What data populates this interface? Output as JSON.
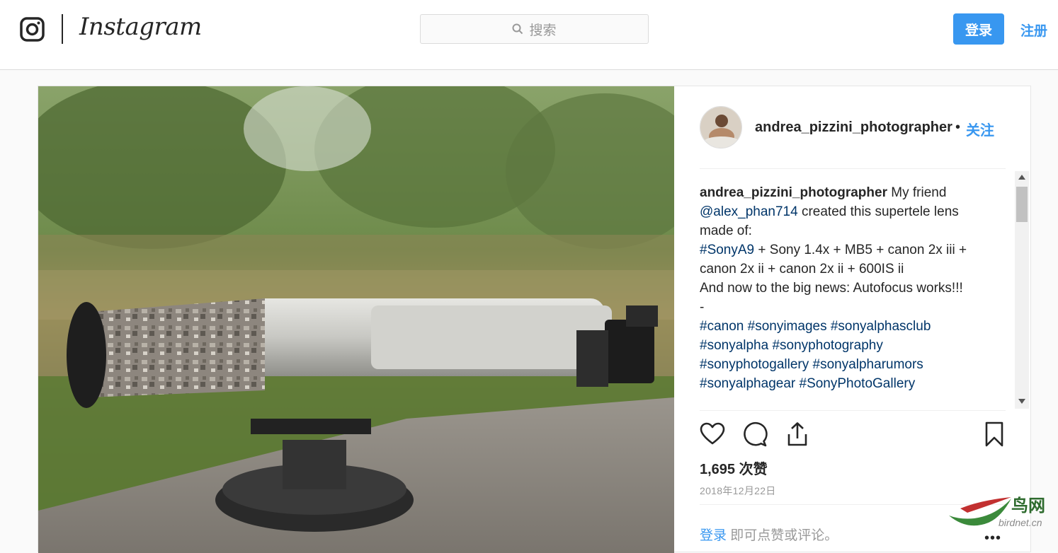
{
  "header": {
    "logo_text": "Instagram",
    "search_placeholder": "搜索",
    "login_label": "登录",
    "signup_label": "注册"
  },
  "post": {
    "author": "andrea_pizzini_photographer",
    "separator": "•",
    "follow_label": "关注",
    "caption": {
      "author": "andrea_pizzini_photographer",
      "text_1": " My friend ",
      "mention": "@alex_phan714",
      "text_2": " created this supertele lens made of:",
      "tag_sonya9": "#SonyA9",
      "text_3": " + Sony 1.4x + MB5 + canon 2x iii + canon 2x ii + canon 2x ii + 600IS ii",
      "text_4": "And now to the big news: Autofocus works!!!",
      "text_5": "-",
      "tags": [
        "#canon",
        "#sonyimages",
        "#sonyalphasclub",
        "#sonyalpha",
        "#sonyphotography",
        "#sonyphotogallery",
        "#sonyalpharumors",
        "#sonyalphagear",
        "#SonyPhotoGallery"
      ]
    },
    "likes_count": "1,695",
    "likes_label": " 次赞",
    "date": "2018年12月22日",
    "comment_login": "登录",
    "comment_prompt": " 即可点赞或评论。",
    "more_label": "•••",
    "icons": [
      "heart-icon",
      "comment-icon",
      "share-icon",
      "bookmark-icon"
    ]
  },
  "watermark": {
    "title": "鸟网",
    "domain": "birdnet.cn"
  },
  "colors": {
    "accent": "#3897f0",
    "hashtag": "#003569",
    "muted": "#999999"
  }
}
